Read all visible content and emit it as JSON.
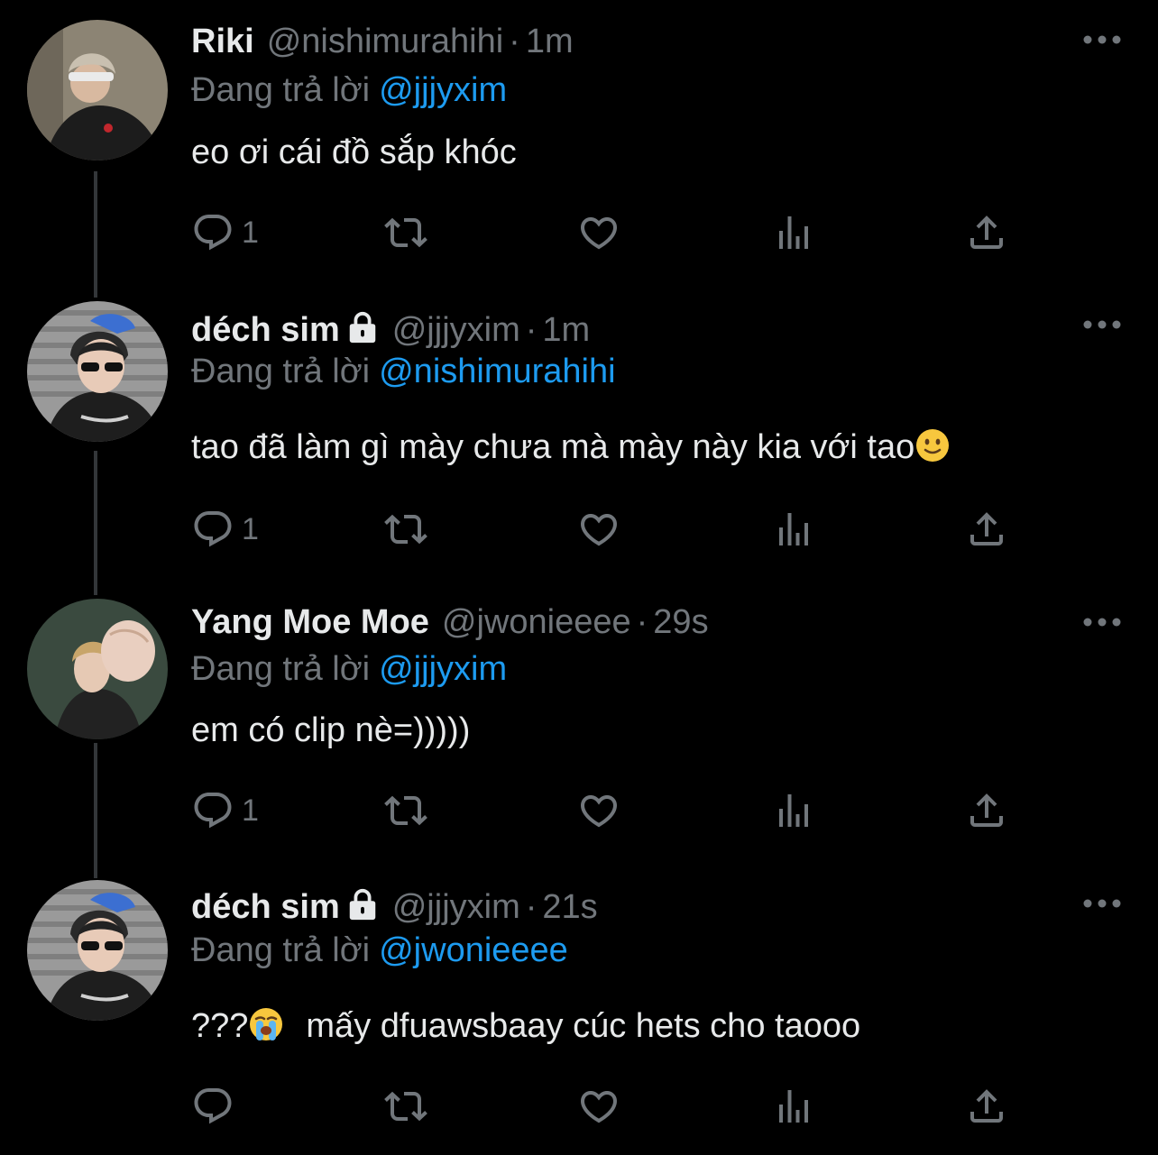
{
  "tweets": [
    {
      "name": "Riki",
      "handle": "@nishimurahihi",
      "separator": "·",
      "time": "1m",
      "reply_prefix": "Đang trả lời",
      "reply_to": "@jjjyxim",
      "text": "eo ơi cái đồ sắp khóc",
      "reply_count": "1",
      "locked": false
    },
    {
      "name": "déch sim",
      "handle": "@jjjyxim",
      "separator": "·",
      "time": "1m",
      "reply_prefix": "Đang trả lời",
      "reply_to": "@nishimurahihi",
      "text": "tao đã làm gì mày chưa mà mày này kia với tao",
      "text_emoji": "slightly-smiling-face",
      "reply_count": "1",
      "locked": true
    },
    {
      "name": "Yang Moe Moe",
      "handle": "@jwonieeee",
      "separator": "·",
      "time": "29s",
      "reply_prefix": "Đang trả lời",
      "reply_to": "@jjjyxim",
      "text": "em có clip nè=)))))",
      "reply_count": "1",
      "locked": false
    },
    {
      "name": "déch sim",
      "handle": "@jjjyxim",
      "separator": "·",
      "time": "21s",
      "reply_prefix": "Đang trả lời",
      "reply_to": "@jwonieeee",
      "text_prefix": "???",
      "text_emoji": "loudly-crying-face",
      "text": "mấy dfuawsbaay cúc hets cho taooo",
      "reply_count": "",
      "locked": true
    }
  ],
  "icons": {
    "reply": "reply-icon",
    "retweet": "retweet-icon",
    "like": "heart-icon",
    "views": "views-icon",
    "share": "share-icon",
    "more": "more-icon",
    "lock": "lock-icon"
  },
  "colors": {
    "background": "#000000",
    "text": "#e7e9ea",
    "secondary": "#71767b",
    "link": "#1d9bf0",
    "thread_line": "#333639"
  }
}
